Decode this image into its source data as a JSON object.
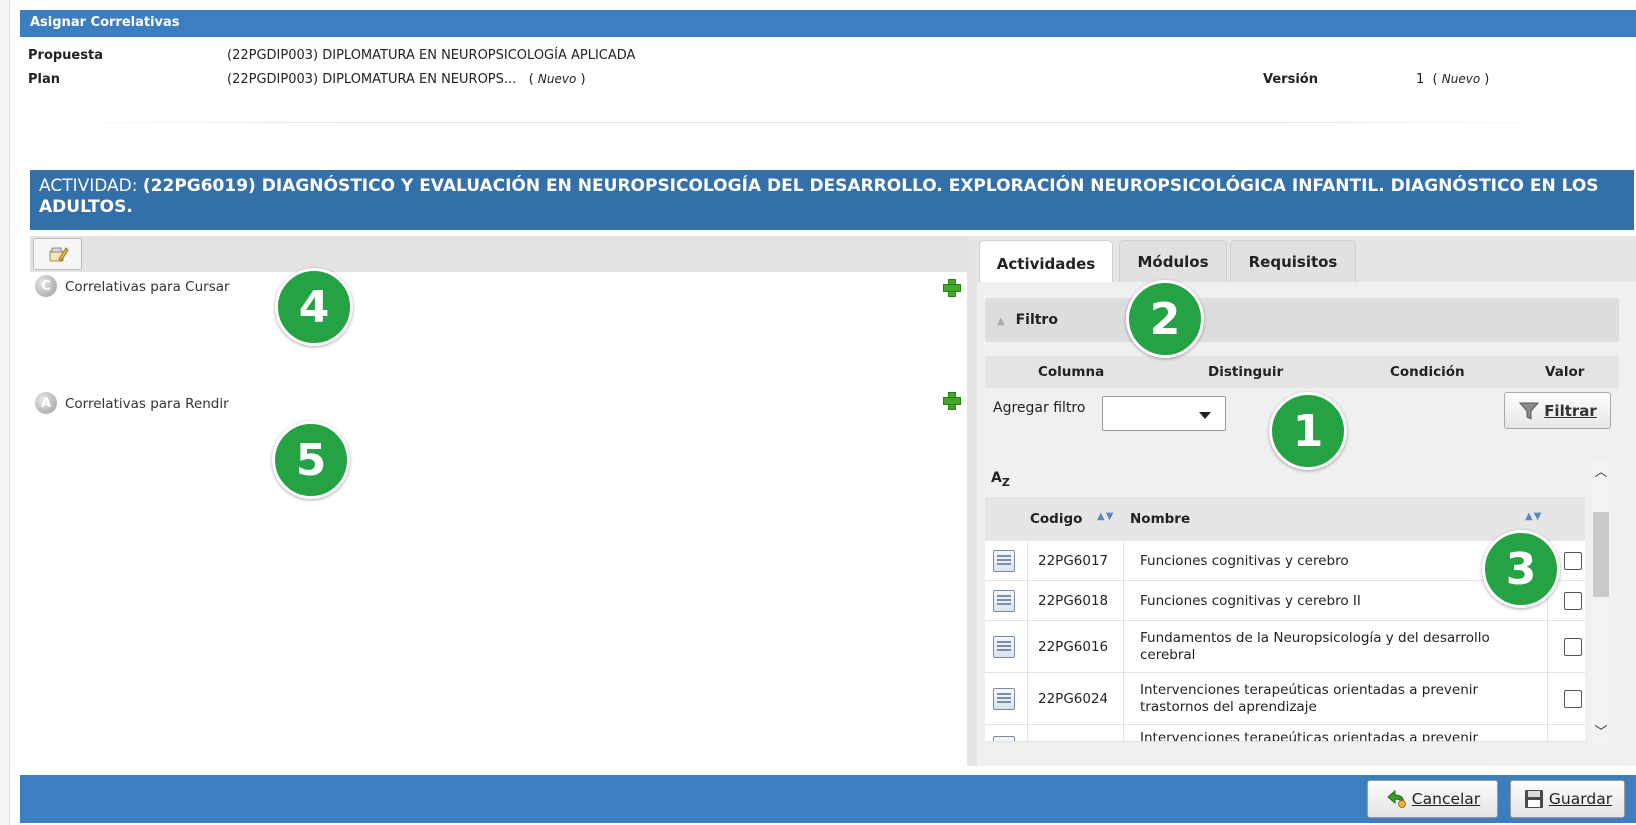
{
  "header": {
    "title": "Asignar Correlativas"
  },
  "meta": {
    "propuesta_label": "Propuesta",
    "propuesta_value": "(22PGDIP003) DIPLOMATURA EN NEUROPSICOLOGÍA APLICADA",
    "plan_label": "Plan",
    "plan_value": "(22PGDIP003) DIPLOMATURA EN NEUROPS...",
    "plan_state_open": "(",
    "plan_state": "Nuevo",
    "plan_state_close": ")",
    "version_label": "Versión",
    "version_value": "1",
    "version_state": "Nuevo"
  },
  "activity": {
    "prefix": "ACTIVIDAD:",
    "name": "(22PG6019) DIAGNÓSTICO Y EVALUACIÓN EN NEUROPSICOLOGÍA DEL DESARROLLO. EXPLORACIÓN NEUROPSICOLÓGICA INFANTIL. DIAGNÓSTICO EN LOS ADULTOS."
  },
  "left": {
    "cursar_icon_letter": "C",
    "cursar_label": "Correlativas para Cursar",
    "rendir_icon_letter": "A",
    "rendir_label": "Correlativas para Rendir"
  },
  "badges": {
    "b1": "1",
    "b2": "2",
    "b3": "3",
    "b4": "4",
    "b5": "5"
  },
  "tabs": {
    "actividades": "Actividades",
    "modulos": "Módulos",
    "requisitos": "Requisitos"
  },
  "filter": {
    "title": "Filtro",
    "col_columna": "Columna",
    "col_distinguir": "Distinguir",
    "col_condicion": "Condición",
    "col_valor": "Valor",
    "agregar_label": "Agregar filtro",
    "agregar_value": "",
    "filtrar_label": "Filtrar"
  },
  "grid": {
    "sort_icon": "AZ",
    "col_codigo": "Codigo",
    "col_nombre": "Nombre",
    "rows": [
      {
        "code": "22PG6017",
        "name": "Funciones cognitivas y cerebro",
        "checked": false
      },
      {
        "code": "22PG6018",
        "name": "Funciones cognitivas y cerebro II",
        "checked": false
      },
      {
        "code": "22PG6016",
        "name": "Fundamentos de la Neuropsicología y del desarrollo cerebral",
        "checked": false
      },
      {
        "code": "22PG6024",
        "name": "Intervenciones terapeúticas orientadas a prevenir trastornos del aprendizaje",
        "checked": false
      },
      {
        "code": "",
        "name": "Intervenciones terapeúticas orientadas a prevenir",
        "checked": false
      }
    ]
  },
  "footer": {
    "cancel_label": "Cancelar",
    "save_label": "Guardar"
  },
  "colors": {
    "header_blue": "#3d7ec0",
    "activity_blue": "#336fa8",
    "badge_green": "#25a244",
    "plus_green": "#43a827"
  },
  "icons": {
    "toolbar": "edit-tool-icon",
    "add": "plus-icon",
    "filter": "funnel-icon",
    "cancel": "back-arrow-icon",
    "save": "floppy-disk-icon",
    "row": "document-list-icon"
  }
}
